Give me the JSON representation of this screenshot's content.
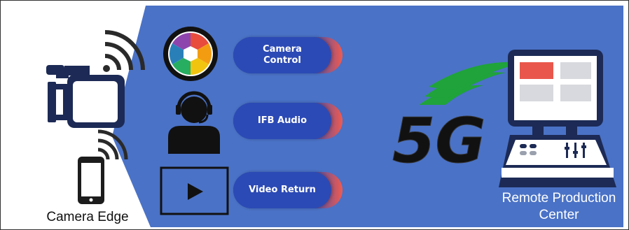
{
  "colors": {
    "background_blue": "#4a72c6",
    "pill_blue": "#2c4ab5",
    "pill_accent": "#f05a4f",
    "icon_navy": "#1c2a55",
    "wave_green": "#1fa33a",
    "text_dark": "#111111",
    "text_light": "#ffffff"
  },
  "left": {
    "caption": "Camera Edge"
  },
  "pills": [
    {
      "label": "Camera\nControl"
    },
    {
      "label": "IFB Audio"
    },
    {
      "label": "Video Return"
    }
  ],
  "network": {
    "logo_text": "5G"
  },
  "right": {
    "caption": "Remote Production\nCenter"
  },
  "icons": [
    "video-camera-icon",
    "wifi-signal-icon",
    "smartphone-icon",
    "camera-aperture-icon",
    "headset-person-icon",
    "video-play-icon",
    "5g-wave-icon",
    "production-console-icon"
  ]
}
